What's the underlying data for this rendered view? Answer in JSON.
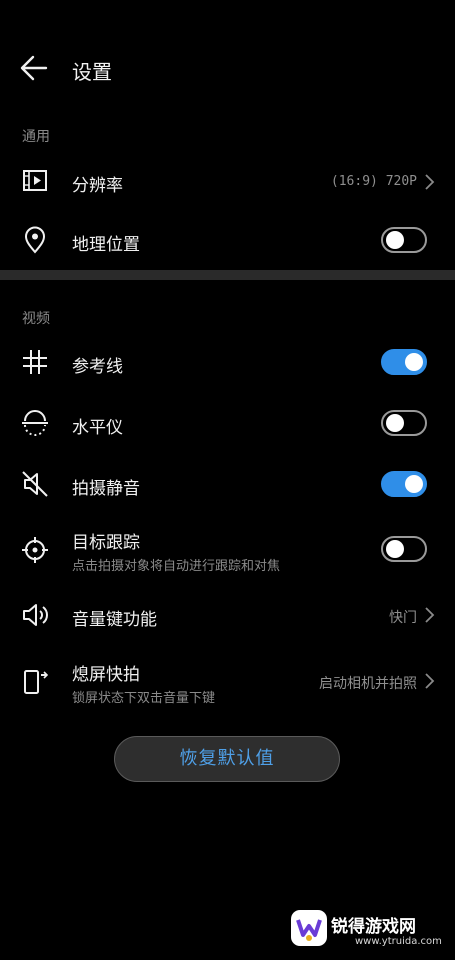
{
  "header": {
    "title": "设置"
  },
  "sections": {
    "general": "通用",
    "video": "视频"
  },
  "rows": {
    "resolution": {
      "label": "分辨率",
      "value": "(16:9) 720P"
    },
    "location": {
      "label": "地理位置",
      "toggle": "off"
    },
    "gridlines": {
      "label": "参考线",
      "toggle": "on"
    },
    "level": {
      "label": "水平仪",
      "toggle": "off"
    },
    "mute": {
      "label": "拍摄静音",
      "toggle": "on"
    },
    "tracking": {
      "label": "目标跟踪",
      "sub": "点击拍摄对象将自动进行跟踪和对焦",
      "toggle": "off"
    },
    "volume_key": {
      "label": "音量键功能",
      "value": "快门"
    },
    "quick_snap": {
      "label": "熄屏快拍",
      "sub": "锁屏状态下双击音量下键",
      "value": "启动相机并拍照"
    }
  },
  "restore_button": "恢复默认值",
  "watermark": {
    "brand": "锐得游戏网",
    "url": "www.ytruida.com"
  },
  "colors": {
    "background": "#000000",
    "accent": "#2f8ee8",
    "text": "#f0f0f0",
    "secondary": "#8a8a8a"
  }
}
